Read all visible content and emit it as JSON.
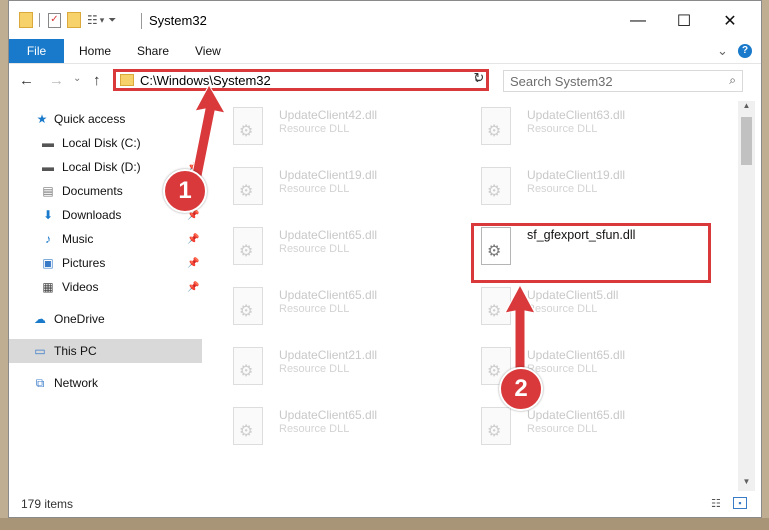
{
  "window": {
    "title": "System32",
    "controls": {
      "minimize": "—",
      "maximize": "☐",
      "close": "✕"
    }
  },
  "ribbon": {
    "tabs": [
      "File",
      "Home",
      "Share",
      "View"
    ],
    "expand_glyph": "⌄",
    "help_glyph": "?"
  },
  "nav": {
    "back": "←",
    "forward": "→",
    "dropdown": "⌄",
    "up": "↑",
    "address": "C:\\Windows\\System32",
    "address_drop": "⌄",
    "refresh": "↻",
    "search_placeholder": "Search System32",
    "search_glyph": "⌕"
  },
  "sidebar": {
    "quick_access": "Quick access",
    "items": [
      {
        "label": "Local Disk (C:)",
        "icon": "drive-icon",
        "pinned": false
      },
      {
        "label": "Local Disk (D:)",
        "icon": "drive-icon",
        "pinned": true
      },
      {
        "label": "Documents",
        "icon": "documents-icon",
        "pinned": true
      },
      {
        "label": "Downloads",
        "icon": "downloads-icon",
        "pinned": true
      },
      {
        "label": "Music",
        "icon": "music-icon",
        "pinned": true
      },
      {
        "label": "Pictures",
        "icon": "pictures-icon",
        "pinned": true
      },
      {
        "label": "Videos",
        "icon": "videos-icon",
        "pinned": true
      }
    ],
    "onedrive": "OneDrive",
    "this_pc": "This PC",
    "network": "Network"
  },
  "files": {
    "left": [
      {
        "name": "UpdateClient42.dll",
        "type": "Resource DLL"
      },
      {
        "name": "UpdateClient19.dll",
        "type": "Resource DLL"
      },
      {
        "name": "UpdateClient65.dll",
        "type": "Resource DLL"
      },
      {
        "name": "UpdateClient65.dll",
        "type": "Resource DLL"
      },
      {
        "name": "UpdateClient21.dll",
        "type": "Resource DLL"
      },
      {
        "name": "UpdateClient65.dll",
        "type": "Resource DLL"
      }
    ],
    "right": [
      {
        "name": "UpdateClient63.dll",
        "type": "Resource DLL"
      },
      {
        "name": "UpdateClient19.dll",
        "type": "Resource DLL"
      },
      {
        "name": "sf_gfexport_sfun.dll",
        "type": ""
      },
      {
        "name": "UpdateClient5.dll",
        "type": "Resource DLL"
      },
      {
        "name": "UpdateClient65.dll",
        "type": "Resource DLL"
      },
      {
        "name": "UpdateClient65.dll",
        "type": "Resource DLL"
      }
    ]
  },
  "status": {
    "count": "179 items"
  },
  "annotations": {
    "step1": "1",
    "step2": "2"
  },
  "colors": {
    "accent": "#1979ca",
    "highlight": "#d9393b"
  }
}
